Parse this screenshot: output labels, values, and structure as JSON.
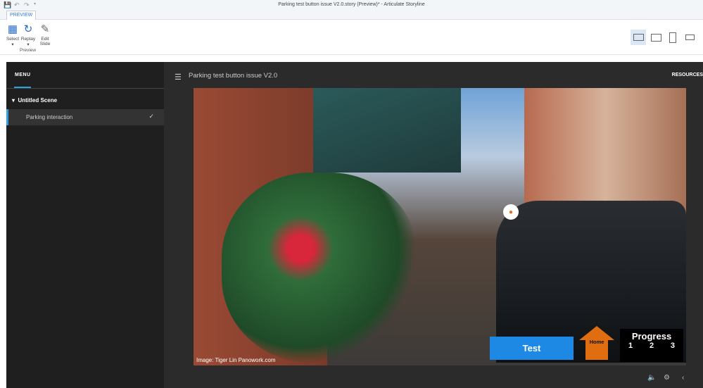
{
  "window": {
    "title": "Parking test button issue V2.0.story (Preview)* - Articulate Storyline"
  },
  "ribbon": {
    "tab": "PREVIEW",
    "buttons": [
      {
        "label": "Select"
      },
      {
        "label": "Replay"
      },
      {
        "label": "Edit Slide"
      }
    ],
    "group": "Preview"
  },
  "player": {
    "menu_heading": "MENU",
    "scene": "Untitled Scene",
    "slide_item": "Parking interaction",
    "title": "Parking test button issue V2.0",
    "resources": "RESOURCES"
  },
  "slide": {
    "credit": "Image: Tiger Lin Panowork.com",
    "test_button": "Test",
    "home_button": "Home",
    "progress": {
      "heading": "Progress",
      "steps": [
        "1",
        "2",
        "3"
      ]
    }
  },
  "colors": {
    "accent": "#2aa0e0",
    "test": "#1e88e5",
    "home": "#e06e10"
  }
}
